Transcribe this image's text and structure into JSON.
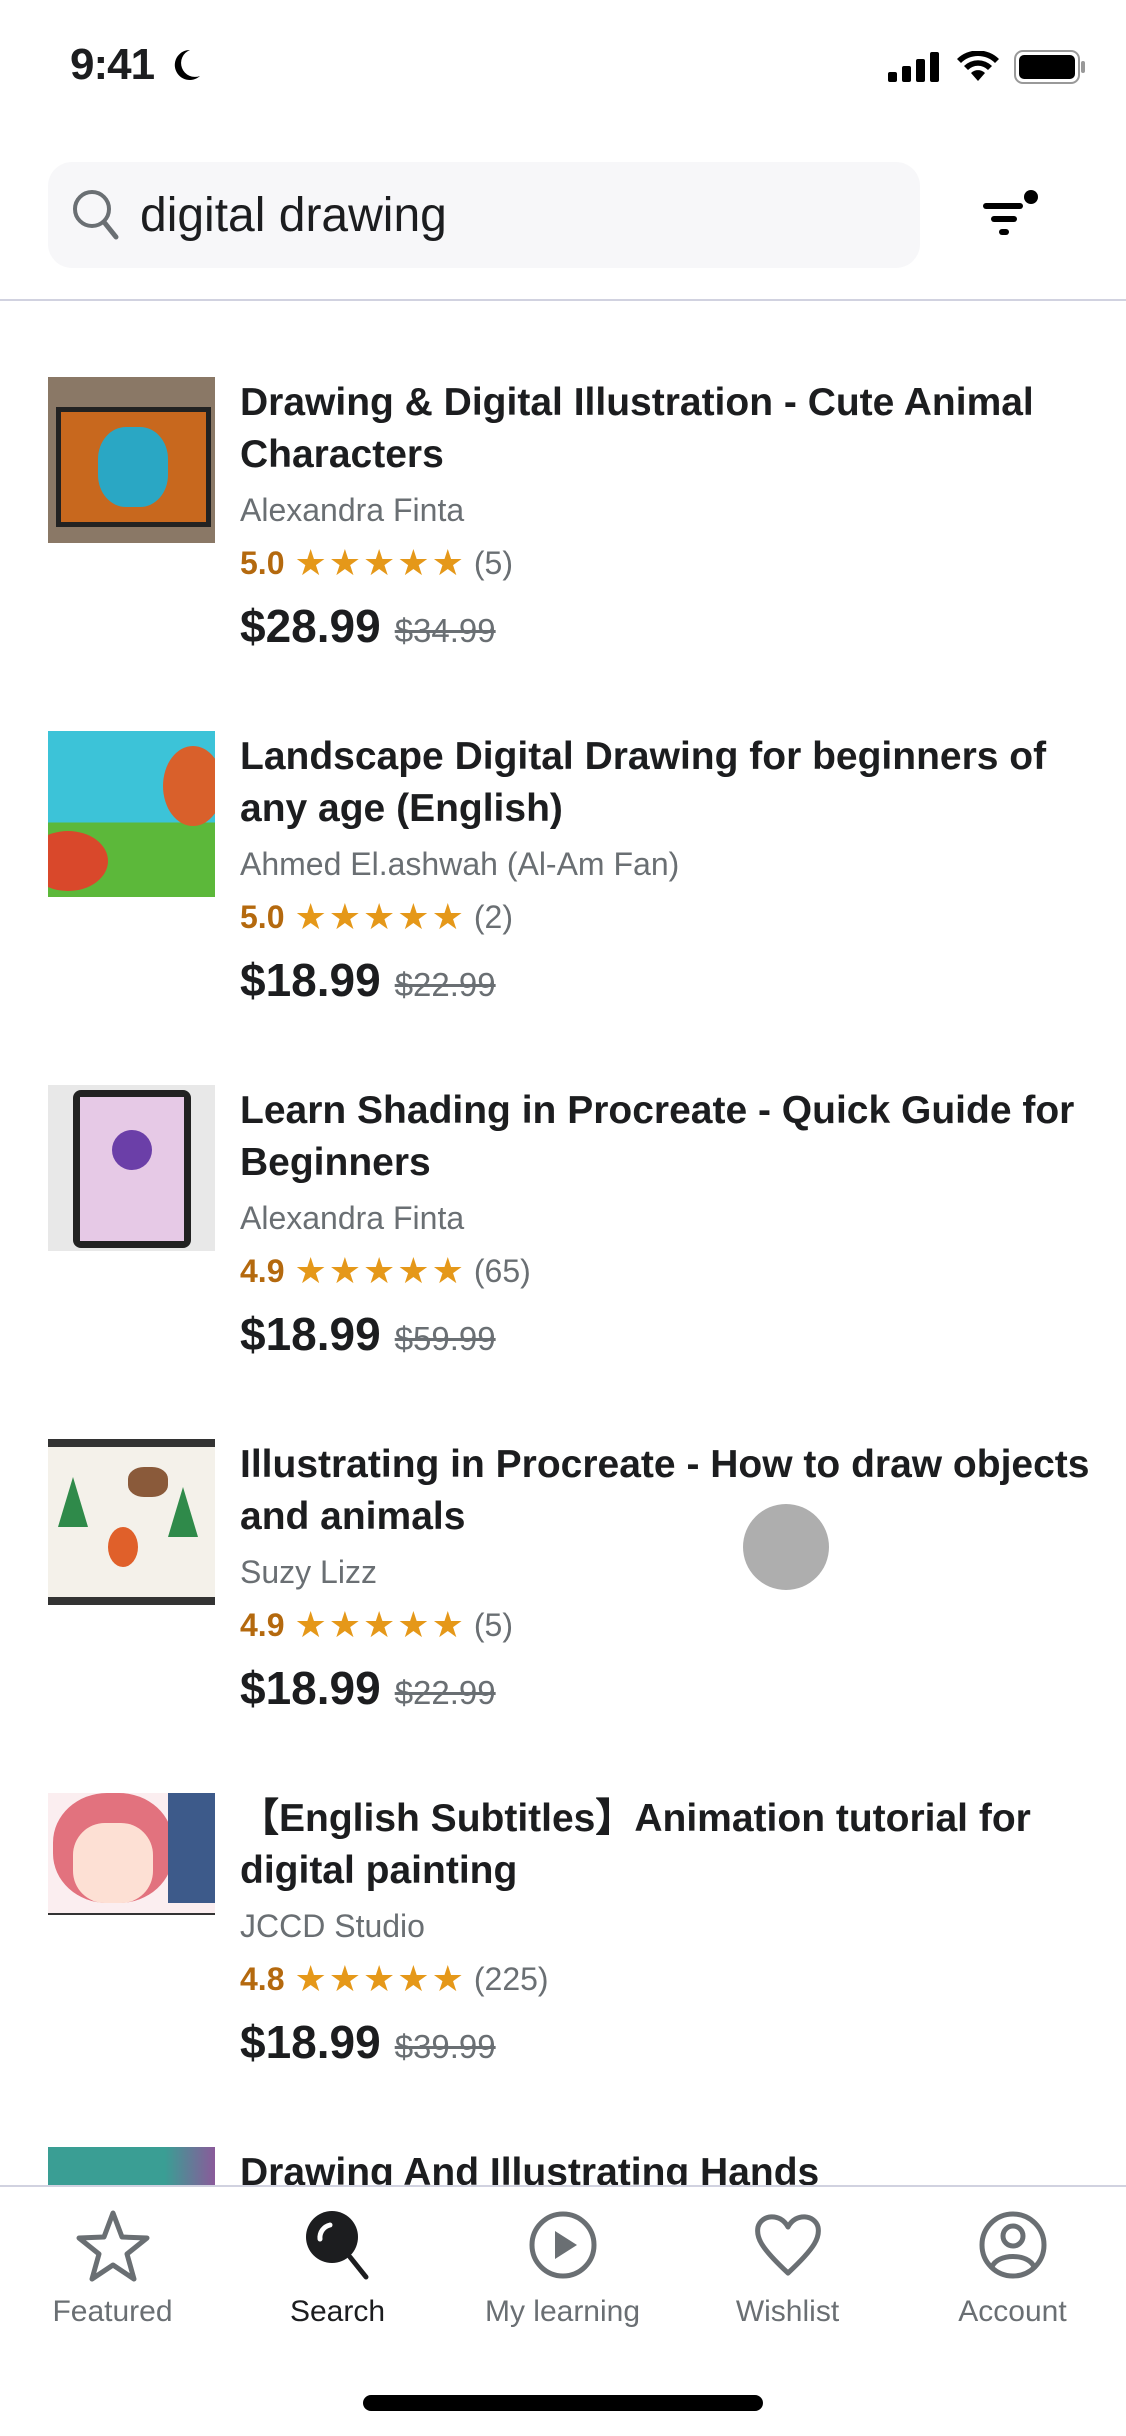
{
  "status_bar": {
    "time": "9:41"
  },
  "search": {
    "query": "digital drawing"
  },
  "courses": [
    {
      "title": "Drawing & Digital Illustration - Cute Animal Characters",
      "author": "Alexandra Finta",
      "rating": "5.0",
      "reviews": "(5)",
      "price": "$28.99",
      "original_price": "$34.99"
    },
    {
      "title": "Landscape Digital Drawing for beginners of any age (English)",
      "author": "Ahmed El.ashwah (Al-Am Fan)",
      "rating": "5.0",
      "reviews": "(2)",
      "price": "$18.99",
      "original_price": "$22.99"
    },
    {
      "title": "Learn Shading in Procreate - Quick Guide for Beginners",
      "author": "Alexandra Finta",
      "rating": "4.9",
      "reviews": "(65)",
      "price": "$18.99",
      "original_price": "$59.99"
    },
    {
      "title": "Illustrating in Procreate - How to draw objects and animals",
      "author": "Suzy Lizz",
      "rating": "4.9",
      "reviews": "(5)",
      "price": "$18.99",
      "original_price": "$22.99"
    },
    {
      "title": "【English Subtitles】Animation tutorial for digital painting",
      "author": "JCCD Studio",
      "rating": "4.8",
      "reviews": "(225)",
      "price": "$18.99",
      "original_price": "$39.99"
    },
    {
      "title": "Drawing And Illustrating Hands"
    }
  ],
  "tabs": [
    {
      "label": "Featured",
      "icon": "star-icon"
    },
    {
      "label": "Search",
      "icon": "search-icon",
      "active": true
    },
    {
      "label": "My learning",
      "icon": "play-circle-icon"
    },
    {
      "label": "Wishlist",
      "icon": "heart-icon"
    },
    {
      "label": "Account",
      "icon": "account-icon"
    }
  ],
  "colors": {
    "rating": "#b4690e",
    "stars": "#e59819",
    "text": "#1c1d1f",
    "muted": "#6a6f73"
  }
}
